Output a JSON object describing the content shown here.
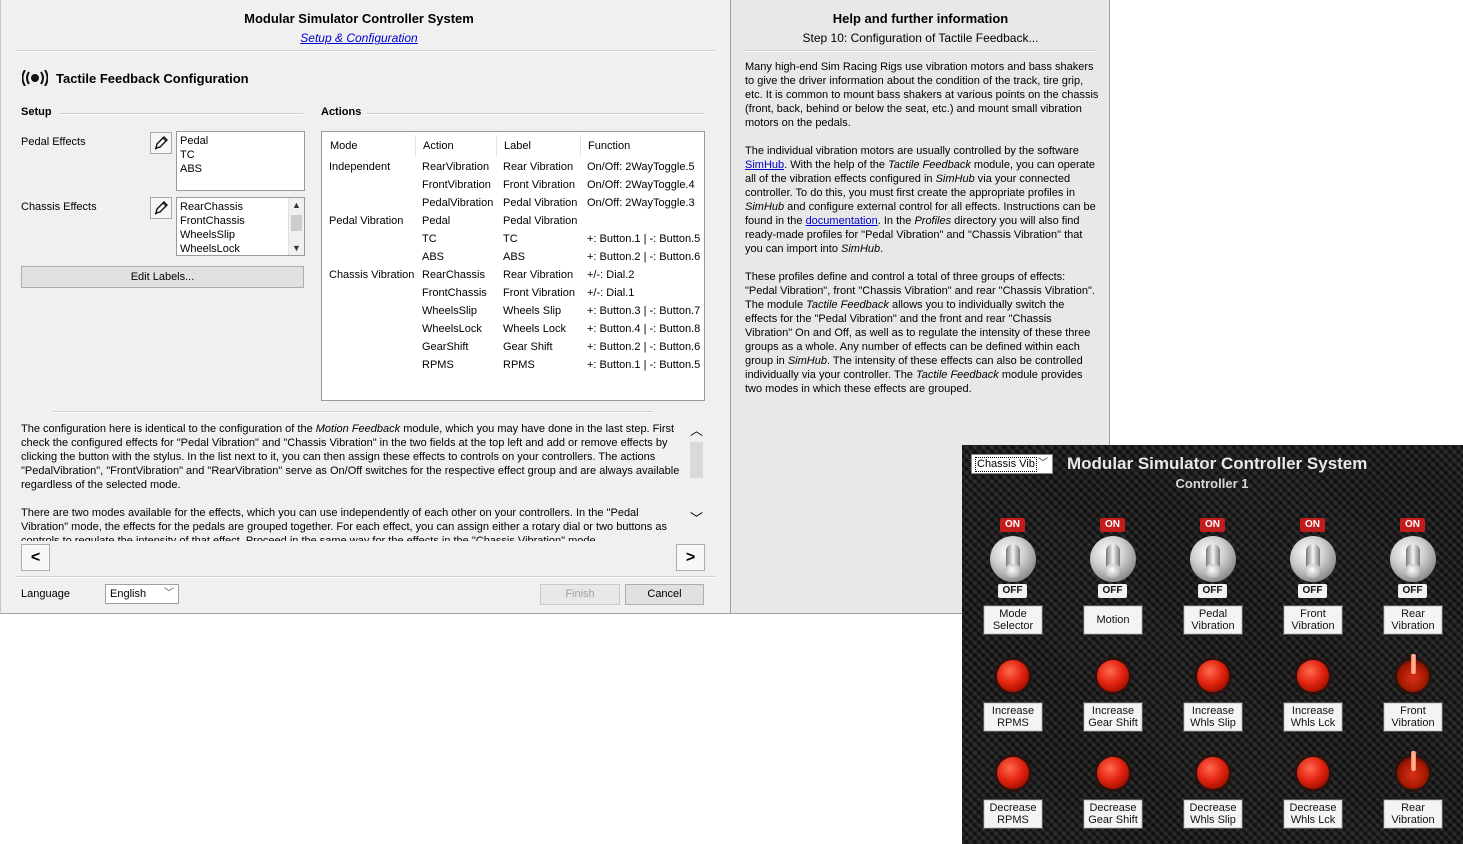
{
  "main": {
    "title": "Modular Simulator Controller System",
    "subtitle_link": "Setup & Configuration",
    "step_title": "Tactile Feedback Configuration",
    "setup": {
      "heading": "Setup",
      "pedal_effects_label": "Pedal Effects",
      "pedal_effects": [
        "Pedal",
        "TC",
        "ABS"
      ],
      "chassis_effects_label": "Chassis Effects",
      "chassis_effects": [
        "RearChassis",
        "FrontChassis",
        "WheelsSlip",
        "WheelsLock"
      ],
      "edit_labels_button": "Edit Labels..."
    },
    "actions": {
      "heading": "Actions",
      "columns": [
        "Mode",
        "Action",
        "Label",
        "Function"
      ],
      "rows": [
        {
          "mode": "Independent",
          "action": "RearVibration",
          "label": "Rear Vibration",
          "function": "On/Off: 2WayToggle.5"
        },
        {
          "mode": "",
          "action": "FrontVibration",
          "label": "Front Vibration",
          "function": "On/Off: 2WayToggle.4"
        },
        {
          "mode": "",
          "action": "PedalVibration",
          "label": "Pedal Vibration",
          "function": "On/Off: 2WayToggle.3"
        },
        {
          "mode": "Pedal Vibration",
          "action": "Pedal",
          "label": "Pedal Vibration",
          "function": ""
        },
        {
          "mode": "",
          "action": "TC",
          "label": "TC",
          "function": "+: Button.1 | -: Button.5"
        },
        {
          "mode": "",
          "action": "ABS",
          "label": "ABS",
          "function": "+: Button.2 | -: Button.6"
        },
        {
          "mode": "Chassis Vibration",
          "action": "RearChassis",
          "label": "Rear Vibration",
          "function": "+/-: Dial.2"
        },
        {
          "mode": "",
          "action": "FrontChassis",
          "label": "Front Vibration",
          "function": "+/-: Dial.1"
        },
        {
          "mode": "",
          "action": "WheelsSlip",
          "label": "Wheels Slip",
          "function": "+: Button.3 | -: Button.7"
        },
        {
          "mode": "",
          "action": "WheelsLock",
          "label": "Wheels Lock",
          "function": "+: Button.4 | -: Button.8"
        },
        {
          "mode": "",
          "action": "GearShift",
          "label": "Gear Shift",
          "function": "+: Button.2 | -: Button.6"
        },
        {
          "mode": "",
          "action": "RPMS",
          "label": "RPMS",
          "function": "+: Button.1 | -: Button.5"
        }
      ]
    },
    "description": {
      "p1_a": "The configuration here is identical to the configuration of the ",
      "p1_em": "Motion Feedback",
      "p1_b": " module, which you may have done in the last step. First check the configured effects for \"Pedal Vibration\" and \"Chassis Vibration\" in the two fields at the top left and add or remove effects by clicking the button with the stylus. In the list next to it, you can then assign these effects to controls on your controllers. The actions \"PedalVibration\", \"FrontVibration\" and \"RearVibration\" serve as On/Off switches for the respective effect group and are always available regardless of the selected mode.",
      "p2": "There are two modes available for the effects, which you can use independently of each other on your controllers. In the \"Pedal Vibration\" mode, the effects for the pedals are grouped together. For each effect, you can assign either a rotary dial or two buttons as controls to regulate the intensity of that effect. Proceed in the same way for the effects in the \"Chassis Vibration\" mode."
    },
    "prev_button": "<",
    "next_button": ">",
    "language_label": "Language",
    "language_value": "English",
    "finish_button": "Finish",
    "cancel_button": "Cancel"
  },
  "help": {
    "title": "Help and further information",
    "subtitle": "Step 10: Configuration of Tactile Feedback...",
    "p1": "Many high-end Sim Racing Rigs use vibration motors and bass shakers to give the driver information about the condition of the track, tire grip, etc. It is common to mount bass shakers at various points on the chassis (front, back, behind or below the seat, etc.) and mount small vibration motors on the pedals.",
    "p2_a": "The individual vibration motors are usually controlled by the software ",
    "p2_link1": "SimHub",
    "p2_b": ". With the help of the ",
    "p2_em1": "Tactile Feedback",
    "p2_c": " module, you can operate all of the vibration effects configured in ",
    "p2_em2": "SimHub",
    "p2_d": " via your connected controller. To do this, you must first create the appropriate profiles in ",
    "p2_em3": "SimHub",
    "p2_e": " and configure external control for all effects. Instructions can be found in the ",
    "p2_link2": "documentation",
    "p2_f": ". In the ",
    "p2_em4": "Profiles",
    "p2_g": " directory you will also find ready-made profiles for \"Pedal Vibration\" and \"Chassis Vibration\" that you can import into ",
    "p2_em5": "SimHub",
    "p2_h": ".",
    "p3_a": "These profiles define and control a total of three groups of effects: \"Pedal Vibration\", front \"Chassis Vibration\" and rear \"Chassis Vibration\". The module ",
    "p3_em1": "Tactile Feedback",
    "p3_b": " allows you to individually switch the effects for the \"Pedal Vibration\" and the front and rear \"Chassis Vibration\" On and Off, as well as to regulate the intensity of these three groups as a whole. Any number of effects can be defined within each group in ",
    "p3_em2": "SimHub",
    "p3_c": ". The intensity of these effects can also be controlled individually via your controller. The ",
    "p3_em3": "Tactile Feedback",
    "p3_d": " module provides two modes in which these effects are grouped."
  },
  "controller": {
    "mode_select": "Chassis Vib",
    "title": "Modular Simulator Controller System",
    "subtitle": "Controller 1",
    "toggle_on": "ON",
    "toggle_off": "OFF",
    "row1": [
      {
        "l1": "Mode",
        "l2": "Selector"
      },
      {
        "l1": "Motion",
        "l2": ""
      },
      {
        "l1": "Pedal",
        "l2": "Vibration"
      },
      {
        "l1": "Front",
        "l2": "Vibration"
      },
      {
        "l1": "Rear",
        "l2": "Vibration"
      }
    ],
    "row2": [
      {
        "l1": "Increase",
        "l2": "RPMS"
      },
      {
        "l1": "Increase",
        "l2": "Gear Shift"
      },
      {
        "l1": "Increase",
        "l2": "Whls Slip"
      },
      {
        "l1": "Increase",
        "l2": "Whls Lck"
      },
      {
        "l1": "Front",
        "l2": "Vibration"
      }
    ],
    "row3": [
      {
        "l1": "Decrease",
        "l2": "RPMS"
      },
      {
        "l1": "Decrease",
        "l2": "Gear Shift"
      },
      {
        "l1": "Decrease",
        "l2": "Whls Slip"
      },
      {
        "l1": "Decrease",
        "l2": "Whls Lck"
      },
      {
        "l1": "Rear",
        "l2": "Vibration"
      }
    ]
  }
}
